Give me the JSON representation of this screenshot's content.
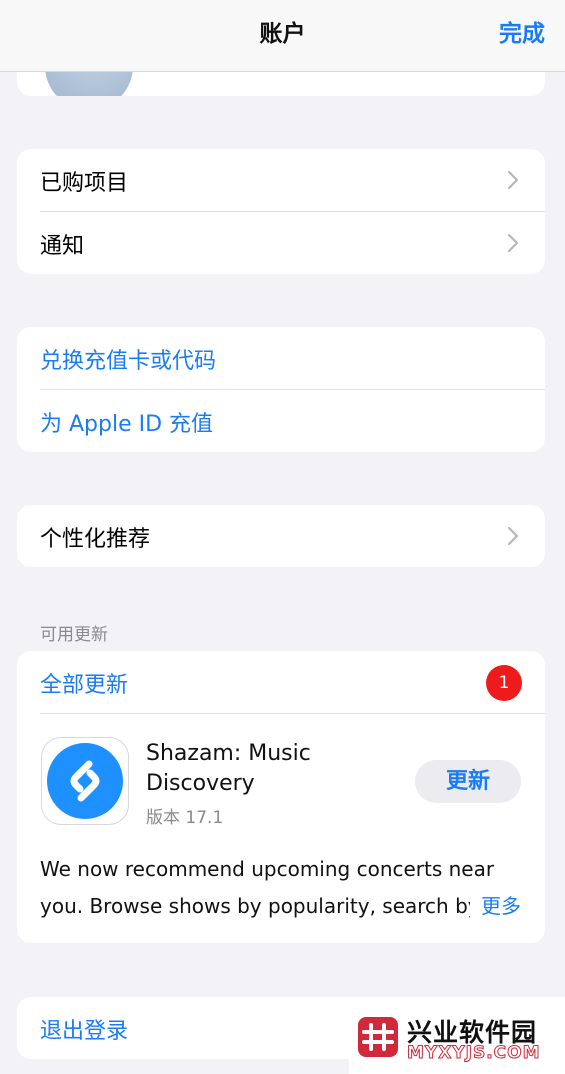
{
  "navbar": {
    "title": "账户",
    "done_label": "完成"
  },
  "menu1": {
    "purchased": "已购项目",
    "notifications": "通知"
  },
  "menu2": {
    "redeem": "兑换充值卡或代码",
    "add_funds": "为 Apple ID 充值"
  },
  "menu3": {
    "personalized": "个性化推荐"
  },
  "updates": {
    "section_header": "可用更新",
    "update_all": "全部更新",
    "badge_count": "1",
    "app": {
      "name": "Shazam: Music Discovery",
      "version": "版本 17.1",
      "update_label": "更新",
      "description_line1": "We now recommend upcoming concerts near",
      "description_line2": "you. Browse shows by popularity, search by",
      "more_label": "更多"
    }
  },
  "signout": {
    "label": "退出登录"
  },
  "watermark": {
    "title": "兴业软件园",
    "subtitle": "MYXYJS.COM"
  },
  "colors": {
    "accent": "#1a7cf5",
    "badge": "#ed1b1b",
    "shazam": "#1e90ff"
  },
  "icons": [
    "chevron-right-icon",
    "shazam-icon",
    "avatar"
  ]
}
